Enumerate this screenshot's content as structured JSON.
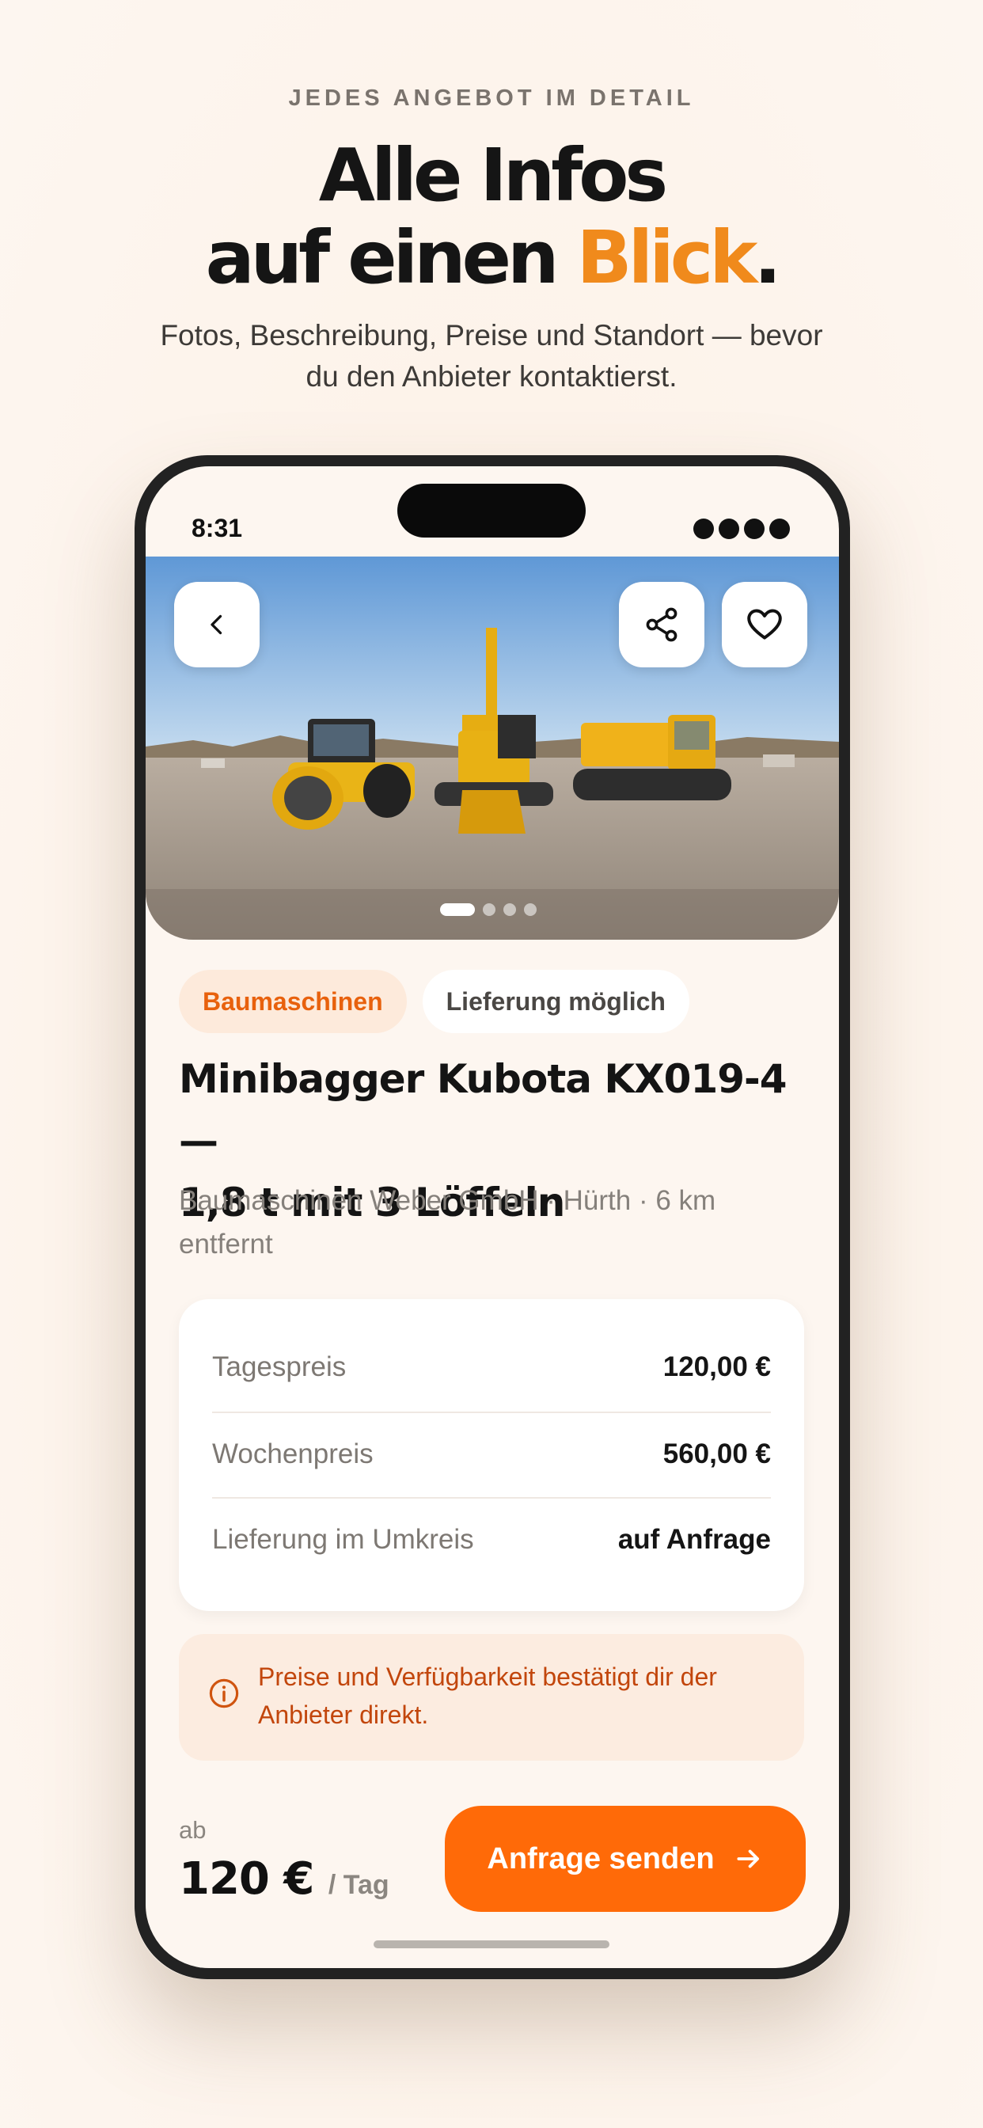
{
  "promo": {
    "eyebrow": "JEDES ANGEBOT IM DETAIL",
    "headline_line1": "Alle Infos",
    "headline_line2_start": "auf einen ",
    "headline_accent": "Blick",
    "headline_end": ".",
    "subhead_line1": "Fotos, Beschreibung, Preise und Standort — bevor",
    "subhead_line2": "du den Anbieter kontaktierst."
  },
  "status_bar": {
    "time": "8:31"
  },
  "hero": {
    "icons": {
      "back": "chevron-left-icon",
      "share": "share-icon",
      "favorite": "heart-icon"
    },
    "carousel": {
      "count": 4,
      "active_index": 0
    }
  },
  "chips": {
    "category": "Baumaschinen",
    "delivery": "Lieferung möglich"
  },
  "listing": {
    "title_line1": "Minibagger Kubota KX019-4 —",
    "title_line2": "1,8 t mit 3 Löffeln",
    "meta_line1": "Baumaschinen Weber GmbH · Hürth · 6 km",
    "meta_line2": "entfernt"
  },
  "prices": [
    {
      "label": "Tagespreis",
      "value": "120,00 €"
    },
    {
      "label": "Wochenpreis",
      "value": "560,00 €"
    },
    {
      "label": "Lieferung im Umkreis",
      "value": "auf Anfrage"
    }
  ],
  "notice": {
    "icon": "info-icon",
    "line1": "Preise und Verfügbarkeit bestätigt dir der",
    "line2": "Anbieter direkt."
  },
  "footer": {
    "prefix": "ab",
    "price": "120 €",
    "unit": "/ Tag",
    "cta_label": "Anfrage senden",
    "cta_icon": "arrow-right-icon"
  },
  "colors": {
    "accent": "#f08a1c",
    "cta": "#ff6a08",
    "notice_text": "#c2460c"
  }
}
